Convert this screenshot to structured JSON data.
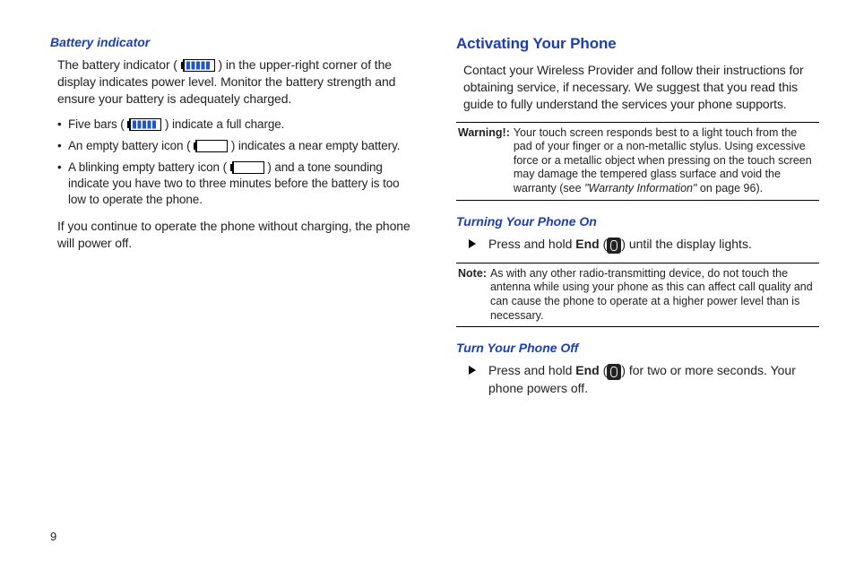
{
  "page_number": "9",
  "left": {
    "heading": "Battery indicator",
    "intro_before": "The battery indicator (",
    "intro_after": ") in the upper-right corner of the display indicates power level. Monitor the battery strength and ensure your battery is adequately charged.",
    "bullets": {
      "b1_before": "Five bars (",
      "b1_after": ") indicate a full charge.",
      "b2_before": "An empty battery icon (",
      "b2_after": ") indicates a near empty battery.",
      "b3_before": "A blinking empty battery icon (",
      "b3_after": ") and a tone sounding indicate you have two to three minutes before the battery is too low to operate the phone."
    },
    "outro": "If you continue to operate the phone without charging, the phone will power off."
  },
  "right": {
    "heading": "Activating Your Phone",
    "intro": "Contact your Wireless Provider and follow their instructions for obtaining service, if necessary. We suggest that you read this guide to fully understand the services your phone supports.",
    "warning": {
      "label": "Warning!:",
      "text_before_ref": "Your touch screen responds best to a light touch from the pad of your finger or a non-metallic stylus. Using excessive force or a metallic object when pressing on the touch screen may damage the tempered glass surface and void the warranty (see ",
      "ref_text": "\"Warranty Information\"",
      "text_after_ref": " on page 96)."
    },
    "sub1": {
      "heading": "Turning Your Phone On",
      "step_before": "Press and hold ",
      "step_bold": "End",
      "step_mid": " (",
      "step_after": ") until the display lights."
    },
    "note": {
      "label": "Note:",
      "text": "As with any other radio-transmitting device, do not touch the antenna while using your phone as this can affect call quality and can cause the phone to operate at a higher power level than is necessary."
    },
    "sub2": {
      "heading": "Turn Your Phone Off",
      "step_before": "Press and hold ",
      "step_bold": "End",
      "step_mid": " (",
      "step_after": ") for two or more seconds. Your phone powers off."
    }
  }
}
